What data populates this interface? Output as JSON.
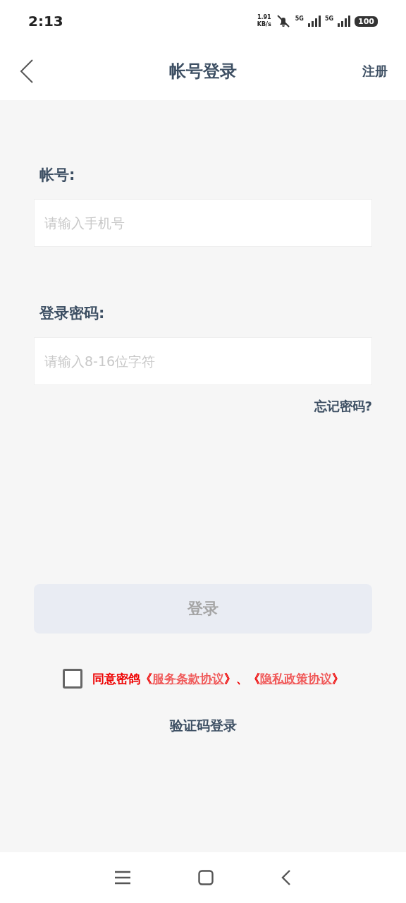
{
  "status_bar": {
    "time": "2:13",
    "speed_value": "1.91",
    "speed_unit": "KB/s",
    "networks": [
      "5G",
      "5G"
    ],
    "battery": "100"
  },
  "header": {
    "title": "帐号登录",
    "action": "注册"
  },
  "form": {
    "fields": [
      {
        "label": "帐号:",
        "placeholder": "请输入手机号"
      },
      {
        "label": "登录密码:",
        "placeholder": "请输入8-16位字符"
      }
    ],
    "forgot": "忘记密码?",
    "submit": {
      "label": "登录",
      "disabled": true
    }
  },
  "agreement": {
    "checked": false,
    "parts": [
      {
        "kind": "text",
        "text": "同意密鸽《"
      },
      {
        "kind": "link",
        "text": "服务条款协议"
      },
      {
        "kind": "text",
        "text": "》、《"
      },
      {
        "kind": "link",
        "text": "隐私政策协议"
      },
      {
        "kind": "text",
        "text": "》"
      }
    ]
  },
  "alt_login": "验证码登录"
}
